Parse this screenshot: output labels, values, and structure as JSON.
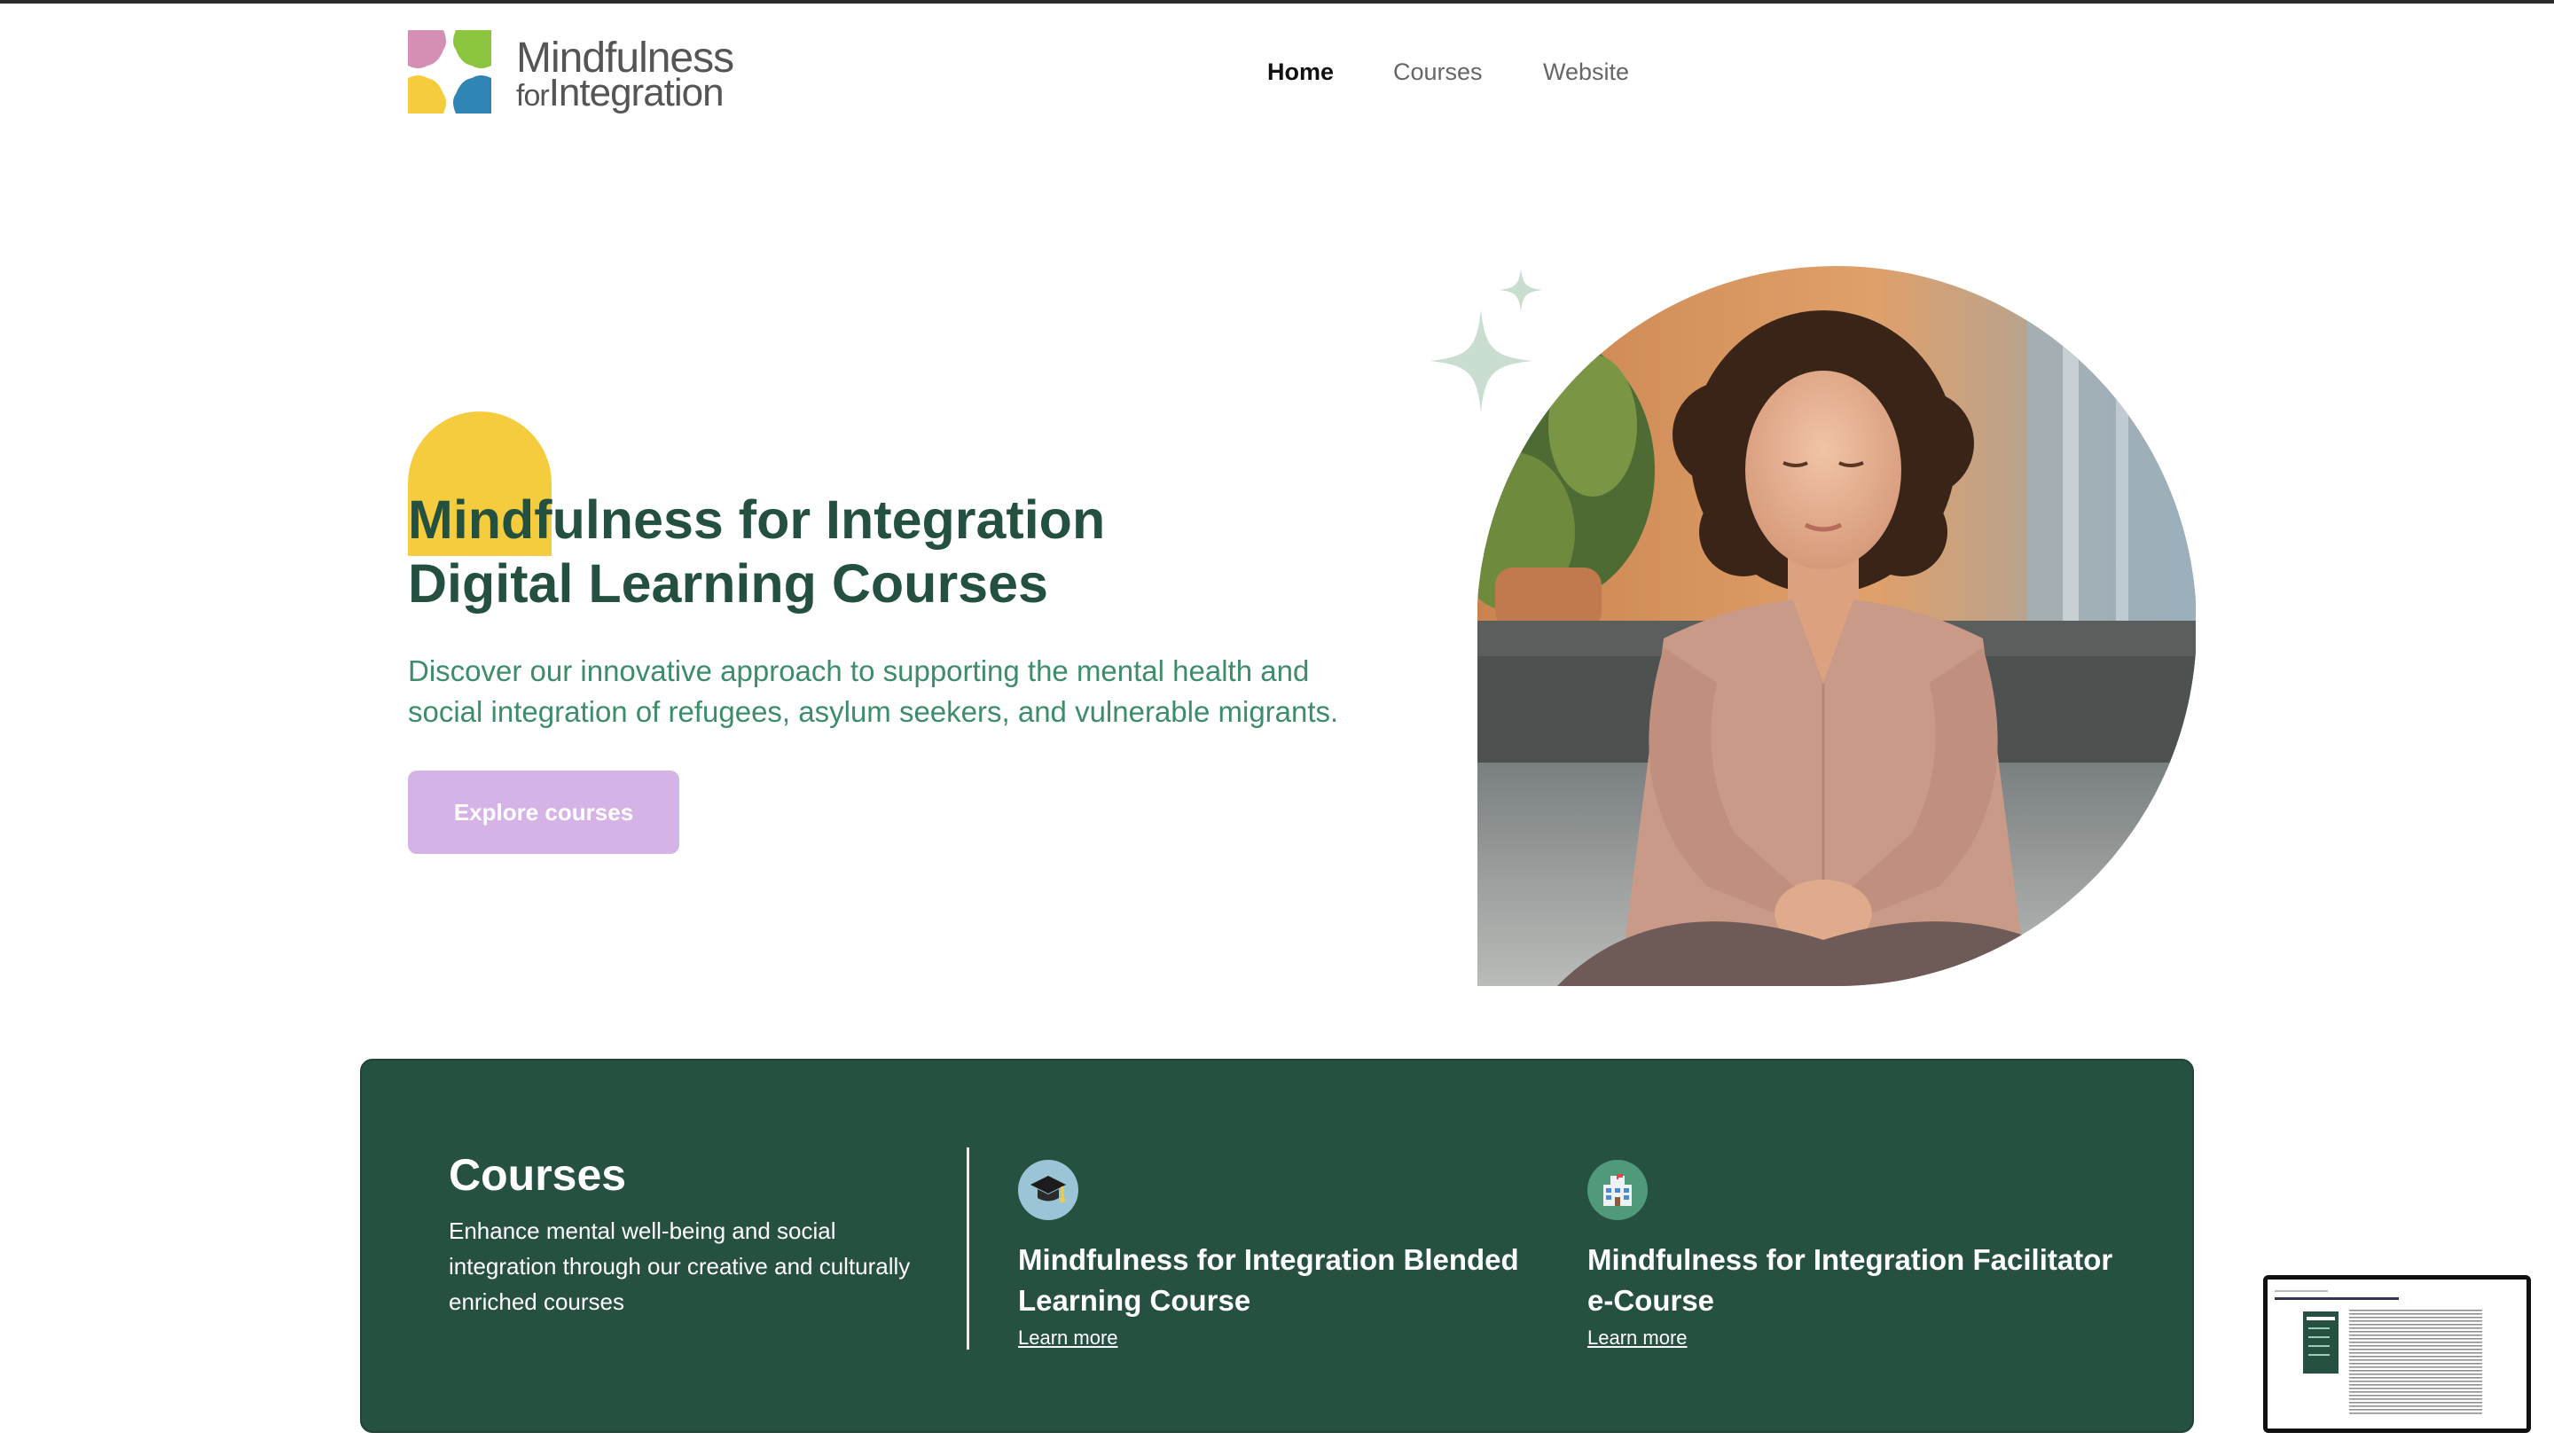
{
  "header": {
    "logo": {
      "line1": "Mindfulness",
      "line2_small": "for",
      "line2": "Integration"
    },
    "nav": [
      {
        "label": "Home",
        "active": true
      },
      {
        "label": "Courses",
        "active": false
      },
      {
        "label": "Website",
        "active": false
      }
    ]
  },
  "hero": {
    "title_line1": "Mindfulness for Integration",
    "title_line2": "Digital Learning Courses",
    "subtitle_line1": "Discover our innovative approach to supporting the mental health and",
    "subtitle_line2": "social integration of refugees, asylum seekers, and vulnerable migrants.",
    "cta_label": "Explore courses",
    "image_alt": "meditating-woman-photo"
  },
  "courses_band": {
    "title": "Courses",
    "description": "Enhance mental well-being and social integration through our creative and culturally enriched courses",
    "items": [
      {
        "icon": "graduation-cap-icon",
        "title": "Mindfulness for Integration Blended Learning Course",
        "link": "Learn more"
      },
      {
        "icon": "school-building-icon",
        "title": "Mindfulness for Integration Facilitator e-Course",
        "link": "Learn more"
      }
    ]
  },
  "colors": {
    "primary_green": "#265040",
    "title_green": "#24503f",
    "subtitle_green": "#3d8c6a",
    "cta_lilac": "#d6b3e6",
    "sun_yellow": "#f5cc3e",
    "sparkle_sage": "#c9ddd1"
  }
}
